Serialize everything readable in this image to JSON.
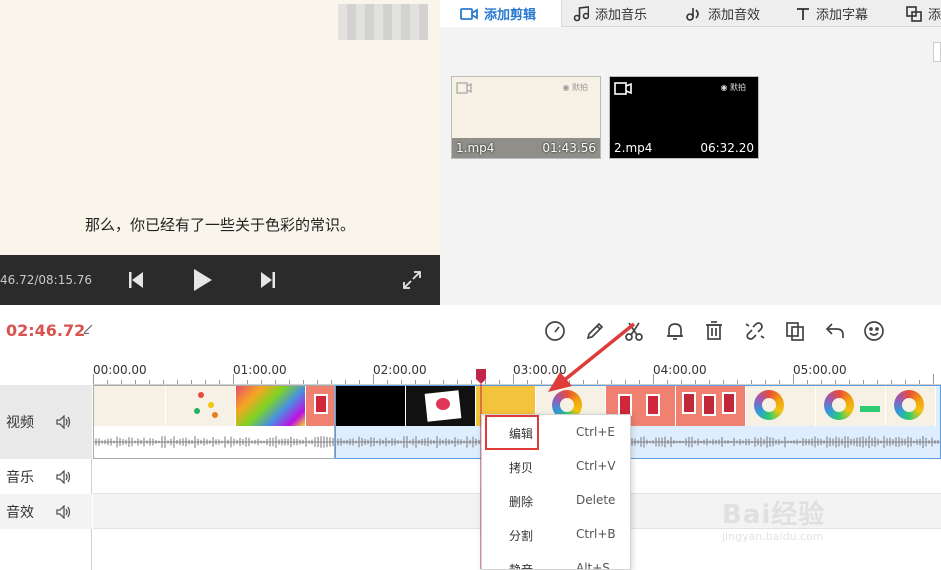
{
  "preview": {
    "subtitle": "那么，你已经有了一些关于色彩的常识。",
    "time_readout": "46.72/08:15.76",
    "prev_icon": "skip-previous-icon",
    "play_icon": "play-icon",
    "next_icon": "skip-next-icon",
    "fullscreen_icon": "fullscreen-icon"
  },
  "tabs": [
    {
      "label": "添加剪辑",
      "icon": "video-camera-icon",
      "active": true
    },
    {
      "label": "添加音乐",
      "icon": "music-note-icon",
      "active": false
    },
    {
      "label": "添加音效",
      "icon": "sound-effect-icon",
      "active": false
    },
    {
      "label": "添加字幕",
      "icon": "text-t-icon",
      "active": false
    },
    {
      "label": "添",
      "icon": "overlay-icon",
      "active": false
    }
  ],
  "clips": [
    {
      "name": "1.mp4",
      "duration": "01:43.56",
      "brand": "◉ 默拍"
    },
    {
      "name": "2.mp4",
      "duration": "06:32.20",
      "brand": "◉ 默拍"
    }
  ],
  "toolbar": {
    "current_time": "02:46.72",
    "tools": [
      "speed-gauge-icon",
      "pencil-icon",
      "scissors-icon",
      "bell-icon",
      "trash-icon",
      "unlink-icon",
      "copy-icon",
      "undo-icon",
      "smiley-icon"
    ]
  },
  "timeline": {
    "ruler_labels": [
      "00:00.00",
      "01:00.00",
      "02:00.00",
      "03:00.00",
      "04:00.00",
      "05:00.00"
    ],
    "tracks": [
      {
        "label": "视频"
      },
      {
        "label": "音乐"
      },
      {
        "label": "音效"
      }
    ]
  },
  "context_menu": [
    {
      "label": "编辑",
      "shortcut": "Ctrl+E"
    },
    {
      "label": "拷贝",
      "shortcut": "Ctrl+V"
    },
    {
      "label": "删除",
      "shortcut": "Delete"
    },
    {
      "label": "分割",
      "shortcut": "Ctrl+B"
    },
    {
      "label": "静音",
      "shortcut": "Alt+S"
    }
  ],
  "watermark": {
    "text": "Bai经验",
    "sub": "jingyan.baidu.com"
  },
  "colors": {
    "accent_blue": "#2a7ad2",
    "time_red": "#d9534f",
    "highlight_red": "#e03b3b"
  }
}
